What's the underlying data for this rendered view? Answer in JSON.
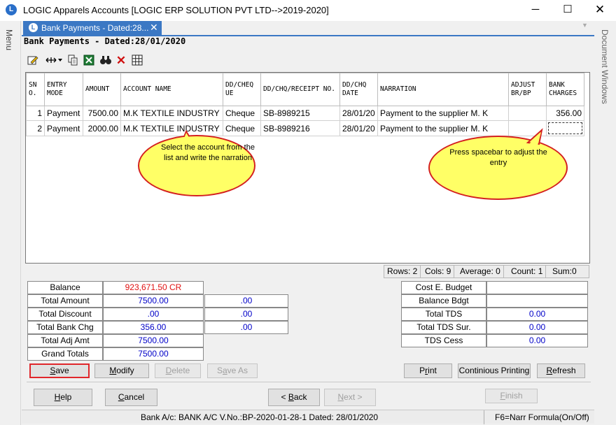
{
  "window": {
    "app_icon": "logic-logo-icon",
    "title": "LOGIC Apparels Accounts  [LOGIC ERP SOLUTION PVT LTD-->2019-2020]",
    "minimize": "─",
    "maximize": "☐",
    "close": "✕"
  },
  "sidebar": {
    "menu_label": "Menu",
    "document_windows_label": "Document Windows"
  },
  "tab": {
    "label": "Bank Payments - Dated:28...",
    "close": "✕",
    "dropdown": "▼"
  },
  "form_title": "Bank Payments - Dated:28/01/2020",
  "toolbar": {
    "icons": [
      "edit-icon",
      "column-width-icon",
      "copy-icon",
      "excel-icon",
      "find-icon",
      "delete-row-icon",
      "grid-icon"
    ]
  },
  "grid": {
    "columns": [
      "SN O.",
      "ENTRY MODE",
      "AMOUNT",
      "ACCOUNT NAME",
      "DD/CHEQ UE",
      "DD/CHQ/RECEIPT NO.",
      "DD/CHQ DATE",
      "NARRATION",
      "ADJUST BR/BP",
      "BANK CHARGES"
    ],
    "rows": [
      {
        "sno": "1",
        "mode": "Payment",
        "amount": "7500.00",
        "account": "M.K TEXTILE INDUSTRY",
        "type": "Cheque",
        "number": "SB-8989215",
        "date": "28/01/20",
        "narration": "Payment to the supplier M. K",
        "adjust": "",
        "charges": "356.00"
      },
      {
        "sno": "2",
        "mode": "Payment",
        "amount": "2000.00",
        "account": "M.K TEXTILE INDUSTRY",
        "type": "Cheque",
        "number": "SB-8989216",
        "date": "28/01/20",
        "narration": "Payment to the supplier M. K",
        "adjust": "",
        "charges": ""
      }
    ]
  },
  "callouts": {
    "account": "Select the account from the list and write the narration",
    "adjust": "Press spacebar to adjust the entry"
  },
  "grid_status": {
    "rows": "Rows: 2",
    "cols": "Cols: 9",
    "average": "Average: 0",
    "count": "Count: 1",
    "sum": "Sum:0"
  },
  "totals_left": [
    {
      "label": "Balance",
      "value": "923,671.50 CR",
      "extra": null
    },
    {
      "label": "Total Amount",
      "value": "7500.00",
      "extra": ".00"
    },
    {
      "label": "Total Discount",
      "value": ".00",
      "extra": ".00"
    },
    {
      "label": "Total Bank Chg",
      "value": "356.00",
      "extra": ".00"
    },
    {
      "label": "Total Adj Amt",
      "value": "7500.00",
      "extra": null
    },
    {
      "label": "Grand Totals",
      "value": "7500.00",
      "extra": null
    }
  ],
  "totals_right": [
    {
      "label": "Cost E. Budget",
      "value": ""
    },
    {
      "label": "Balance Bdgt",
      "value": ""
    },
    {
      "label": "Total TDS",
      "value": "0.00"
    },
    {
      "label": "Total TDS Sur.",
      "value": "0.00"
    },
    {
      "label": "TDS Cess",
      "value": "0.00"
    }
  ],
  "buttons": {
    "save": "Save",
    "modify": "Modify",
    "delete": "Delete",
    "save_as": "Save As",
    "print": "Print",
    "continious_printing": "Continious Printing",
    "refresh": "Refresh",
    "help": "Help",
    "cancel": "Cancel",
    "back": "< Back",
    "next": "Next >",
    "finish": "Finish"
  },
  "status_bar": {
    "main": "Bank A/c: BANK A/C V.No.:BP-2020-01-28-1 Dated: 28/01/2020",
    "right": "F6=Narr Formula(On/Off)"
  },
  "colors": {
    "accent": "#3b78c4",
    "balloon_fill": "#ffff66",
    "balloon_border": "#d42020",
    "value_blue": "#0000c8",
    "value_red": "#e01010"
  }
}
